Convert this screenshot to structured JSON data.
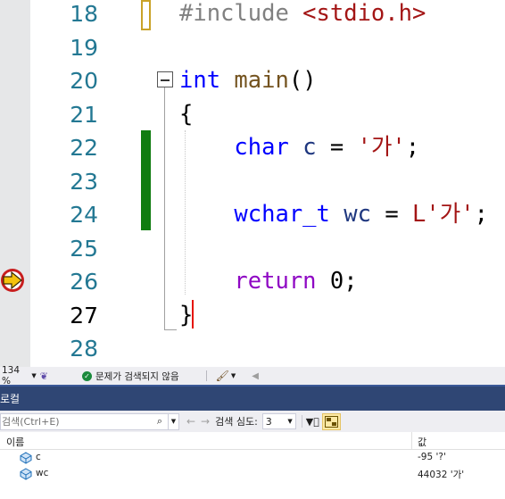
{
  "editor": {
    "lines": [
      {
        "number": "18",
        "tokens": [
          {
            "t": "#include ",
            "c": "pp"
          },
          {
            "t": "<stdio.h>",
            "c": "inc"
          }
        ]
      },
      {
        "number": "19",
        "tokens": []
      },
      {
        "number": "20",
        "tokens": [
          {
            "t": "int",
            "c": "kw"
          },
          {
            "t": " ",
            "c": "punct"
          },
          {
            "t": "main",
            "c": "fn"
          },
          {
            "t": "()",
            "c": "punct"
          }
        ]
      },
      {
        "number": "21",
        "tokens": [
          {
            "t": "{",
            "c": "punct"
          }
        ]
      },
      {
        "number": "22",
        "tokens": [
          {
            "t": "    ",
            "c": "punct"
          },
          {
            "t": "char",
            "c": "kw"
          },
          {
            "t": " ",
            "c": "punct"
          },
          {
            "t": "c",
            "c": "var"
          },
          {
            "t": " = ",
            "c": "punct"
          },
          {
            "t": "'가'",
            "c": "str"
          },
          {
            "t": ";",
            "c": "punct"
          }
        ]
      },
      {
        "number": "23",
        "tokens": []
      },
      {
        "number": "24",
        "tokens": [
          {
            "t": "    ",
            "c": "punct"
          },
          {
            "t": "wchar_t",
            "c": "kw"
          },
          {
            "t": " ",
            "c": "punct"
          },
          {
            "t": "wc",
            "c": "var"
          },
          {
            "t": " = ",
            "c": "punct"
          },
          {
            "t": "L'가'",
            "c": "str"
          },
          {
            "t": ";",
            "c": "punct"
          }
        ]
      },
      {
        "number": "25",
        "tokens": []
      },
      {
        "number": "26",
        "tokens": [
          {
            "t": "    ",
            "c": "punct"
          },
          {
            "t": "return",
            "c": "ctl"
          },
          {
            "t": " ",
            "c": "punct"
          },
          {
            "t": "0",
            "c": "num"
          },
          {
            "t": ";",
            "c": "punct"
          }
        ]
      },
      {
        "number": "27",
        "tokens": [
          {
            "t": "}",
            "c": "punct"
          }
        ]
      },
      {
        "number": "28",
        "tokens": []
      }
    ],
    "current_line": "27",
    "execution_line": "26"
  },
  "status": {
    "zoom": "134 %",
    "issues_text": "문제가 검색되지 않음"
  },
  "locals": {
    "title": "로컬",
    "search_placeholder": "검색(Ctrl+E)",
    "search_depth_label": "검색 심도:",
    "search_depth_value": "3",
    "columns": {
      "name": "이름",
      "value": "값"
    },
    "rows": [
      {
        "name": "c",
        "value": "-95 '?'"
      },
      {
        "name": "wc",
        "value": "44032 '가'"
      }
    ]
  },
  "colors": {
    "change_bar": "#107c10",
    "caret": "#e51400",
    "tool_title_bg": "#2f4674",
    "keyword": "#0000ff",
    "string": "#a31515",
    "control_keyword": "#8f08c4"
  }
}
